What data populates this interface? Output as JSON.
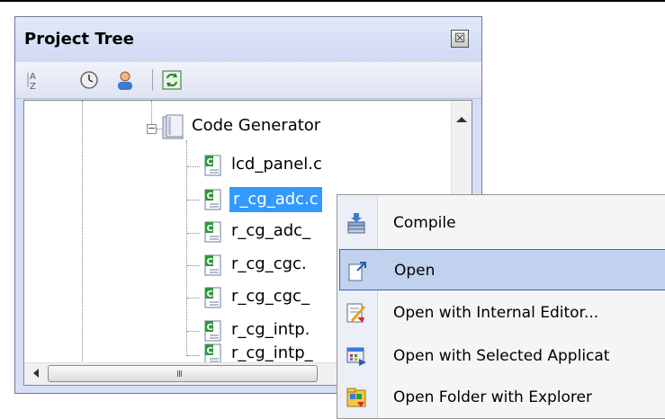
{
  "panel": {
    "title": "Project Tree",
    "close_symbol": "☒",
    "toolbar": [
      {
        "icon": "sort-az-icon"
      },
      {
        "icon": "clock-icon"
      },
      {
        "icon": "user-icon"
      },
      {
        "icon": "refresh-icon"
      }
    ]
  },
  "tree": {
    "folder": {
      "label": "Code Generator",
      "expander": "−",
      "icon": "folder-icon"
    },
    "files": [
      {
        "label": "lcd_panel.c",
        "icon": "c-file-icon",
        "selected": false
      },
      {
        "label": "r_cg_adc.c",
        "icon": "c-file-icon",
        "selected": true
      },
      {
        "label": "r_cg_adc_",
        "icon": "c-file-icon",
        "selected": false
      },
      {
        "label": "r_cg_cgc.",
        "icon": "c-file-icon",
        "selected": false
      },
      {
        "label": "r_cg_cgc_",
        "icon": "c-file-icon",
        "selected": false
      },
      {
        "label": "r_cg_intp.",
        "icon": "c-file-icon",
        "selected": false
      },
      {
        "label": "r_cg_intp_",
        "icon": "c-file-icon",
        "selected": false
      }
    ],
    "hscroll_grip": "III"
  },
  "context_menu": {
    "items": [
      {
        "label": "Compile",
        "icon": "compile-icon",
        "highlighted": false
      },
      {
        "label": "Open",
        "icon": "open-icon",
        "highlighted": true
      },
      {
        "label": "Open with Internal Editor...",
        "icon": "internal-editor-icon",
        "highlighted": false
      },
      {
        "label": "Open with Selected Applicat",
        "icon": "selected-app-icon",
        "highlighted": false
      },
      {
        "label": "Open Folder with Explorer",
        "icon": "explorer-folder-icon",
        "highlighted": false
      }
    ]
  },
  "colors": {
    "selection": "#3399ff",
    "menu_highlight": "#c1d2ee",
    "panel_bg": "#d6dff7"
  }
}
